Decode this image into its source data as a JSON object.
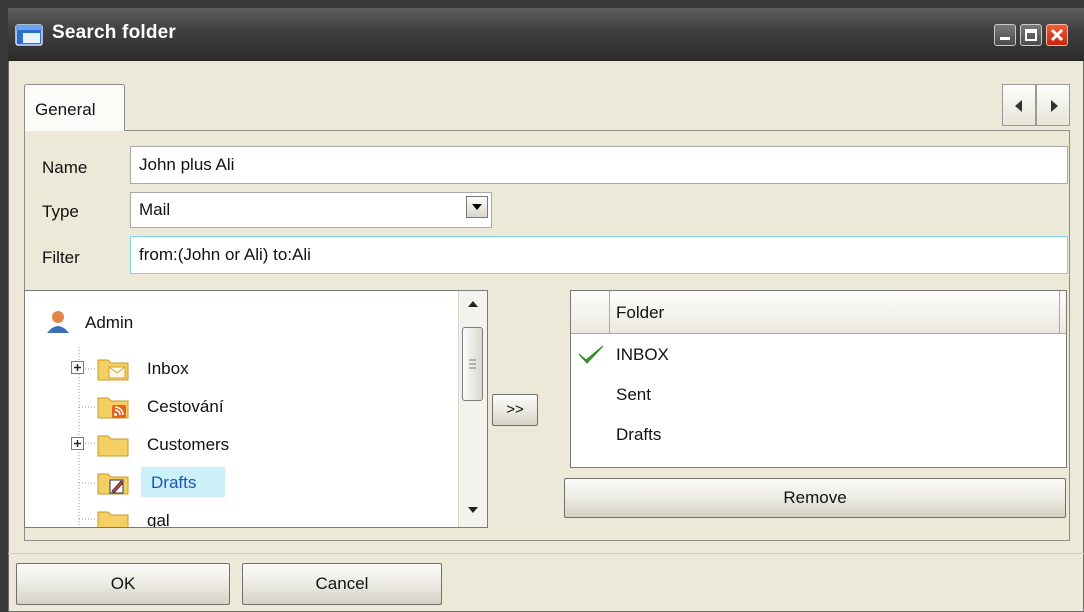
{
  "window": {
    "title": "Search folder"
  },
  "tabs": [
    {
      "label": "General"
    }
  ],
  "form": {
    "name_label": "Name",
    "name_value": "John plus Ali",
    "type_label": "Type",
    "type_value": "Mail",
    "filter_label": "Filter",
    "filter_value": "from:(John or Ali) to:Ali"
  },
  "tree": {
    "root": "Admin",
    "items": [
      {
        "label": "Inbox",
        "icon": "inbox-folder-icon",
        "expandable": true
      },
      {
        "label": "Cestování",
        "icon": "rss-folder-icon",
        "expandable": false
      },
      {
        "label": "Customers",
        "icon": "folder-icon",
        "expandable": true
      },
      {
        "label": "Drafts",
        "icon": "drafts-folder-icon",
        "expandable": false,
        "selected": true
      },
      {
        "label": "gal",
        "icon": "folder-icon",
        "expandable": false
      }
    ]
  },
  "add_button": ">>",
  "folder_list": {
    "header": "Folder",
    "rows": [
      {
        "label": "INBOX",
        "checked": true
      },
      {
        "label": "Sent",
        "checked": false
      },
      {
        "label": "Drafts",
        "checked": false
      }
    ]
  },
  "remove_button": "Remove",
  "footer": {
    "ok": "OK",
    "cancel": "Cancel"
  },
  "colors": {
    "title_bar": "#3f3f3f",
    "dialog_bg": "#ece9d8",
    "selection": "#cdf1f9",
    "focus_border": "#7fd3e6",
    "check": "#3aa52a"
  }
}
